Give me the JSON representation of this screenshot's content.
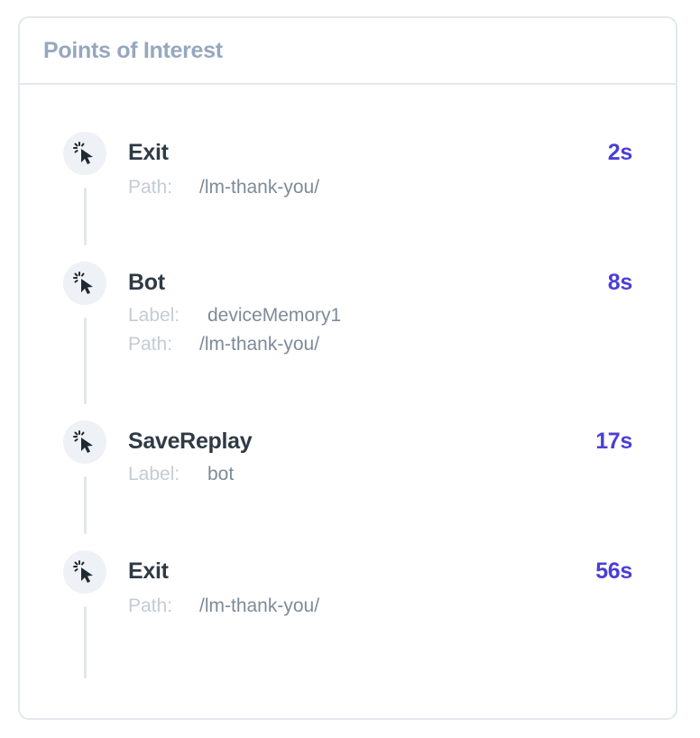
{
  "panel": {
    "title": "Points of Interest"
  },
  "events": [
    {
      "title": "Exit",
      "time": "2s",
      "icon": "cursor-click-icon",
      "path_key": "Path:",
      "path_value": "/lm-thank-you/"
    },
    {
      "title": "Bot",
      "time": "8s",
      "icon": "cursor-click-icon",
      "label_key": "Label:",
      "label_value": "deviceMemory1",
      "path_key": "Path:",
      "path_value": "/lm-thank-you/"
    },
    {
      "title": "SaveReplay",
      "time": "17s",
      "icon": "cursor-click-icon",
      "label_key": "Label:",
      "label_value": "bot"
    },
    {
      "title": "Exit",
      "time": "56s",
      "icon": "cursor-click-icon",
      "path_key": "Path:",
      "path_value": "/lm-thank-you/"
    }
  ],
  "colors": {
    "accent": "#4a3fd6",
    "title_text": "#2f3a45",
    "header_text": "#95a8bd",
    "meta_key": "#c3ccd5",
    "meta_value": "#7d8b99",
    "border": "#e2e8ee",
    "icon_bg": "#eef1f5"
  }
}
